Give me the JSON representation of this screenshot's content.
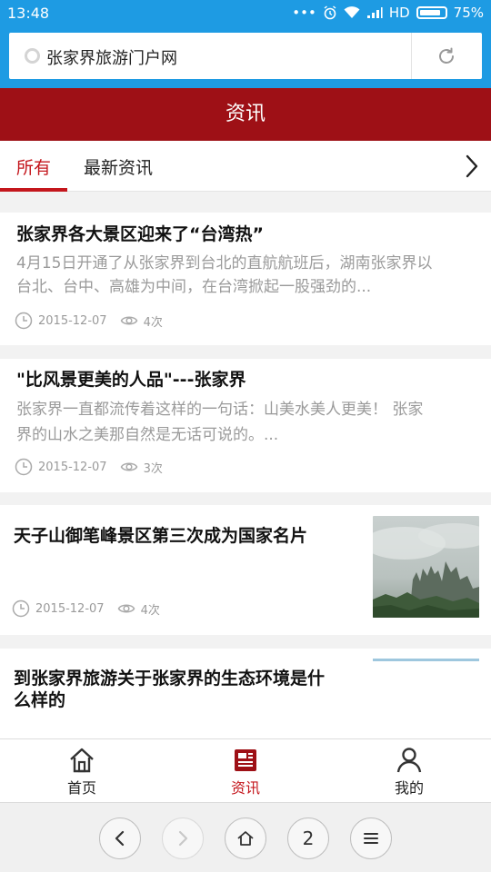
{
  "status_bar": {
    "time": "13:48",
    "network": "HD",
    "battery": "75%"
  },
  "address_bar": {
    "url_text": "张家界旅游门户网"
  },
  "title_bar": {
    "title": "资讯"
  },
  "tabs": [
    {
      "label": "所有",
      "active": true
    },
    {
      "label": "最新资讯",
      "active": false
    }
  ],
  "articles": [
    {
      "title": "张家界各大景区迎来了“台湾热”",
      "summary_line1": "4月15日开通了从张家界到台北的直航航班后，湖南张家界以",
      "summary_line2": "台北、台中、高雄为中间，在台湾掀起一股强劲的...",
      "date": "2015-12-07",
      "views": "4次"
    },
    {
      "title": "\"比风景更美的人品\"---张家界",
      "summary_line1": "张家界一直都流传着这样的一句话：山美水美人更美！    张家",
      "summary_line2": "界的山水之美那自然是无话可说的。...",
      "date": "2015-12-07",
      "views": "3次"
    },
    {
      "title": "天子山御笔峰景区第三次成为国家名片",
      "date": "2015-12-07",
      "views": "4次",
      "thumbnail": "misty-mountain-peaks-photo"
    },
    {
      "title_line1": "到张家界旅游关于张家界的生态环境是什",
      "title_line2": "么样的"
    }
  ],
  "bottom_nav": [
    {
      "label": "首页",
      "icon": "home-icon",
      "active": false
    },
    {
      "label": "资讯",
      "icon": "news-icon",
      "active": true
    },
    {
      "label": "我的",
      "icon": "user-icon",
      "active": false
    }
  ],
  "browser_toolbar": {
    "tab_count": "2"
  },
  "colors": {
    "status_blue": "#1e9be3",
    "brand_red": "#9e1016",
    "accent_red": "#c4161c"
  }
}
